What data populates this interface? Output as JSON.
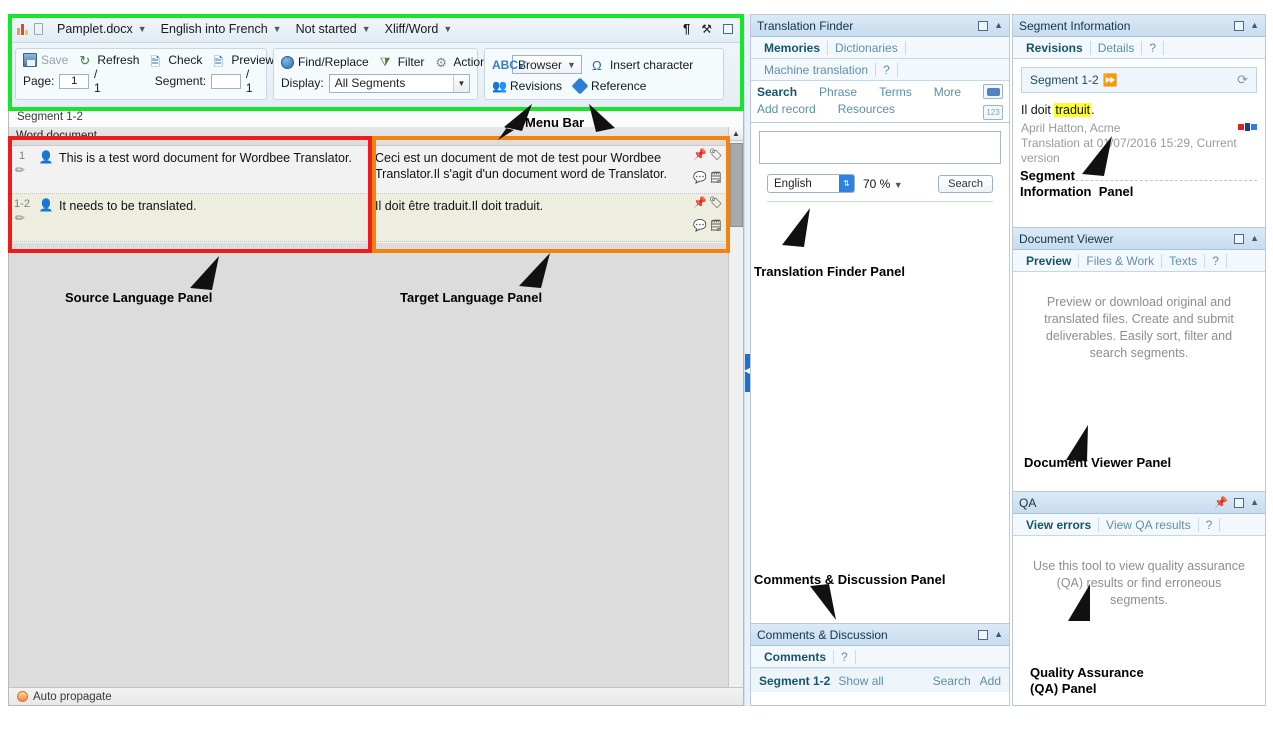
{
  "topbar": {
    "filename": "Pamplet.docx",
    "language_pair": "English into French",
    "status": "Not started",
    "format": "Xliff/Word",
    "icons": {
      "paragraph": "¶",
      "tools": "⚒",
      "window": "▭"
    }
  },
  "toolbar": {
    "save": "Save",
    "refresh": "Refresh",
    "check": "Check",
    "preview": "Preview",
    "page_label": "Page:",
    "page_value": "1",
    "page_total": "/ 1",
    "segment_label": "Segment:",
    "segment_value": "",
    "segment_total": "/ 1",
    "find_replace": "Find/Replace",
    "filter": "Filter",
    "actions": "Actions",
    "display_label": "Display:",
    "display_value": "All Segments",
    "browser": "Browser",
    "insert_character": "Insert character",
    "revisions": "Revisions",
    "reference": "Reference"
  },
  "grid": {
    "segment_strip": "Segment 1-2",
    "source_column_header": "Word document",
    "rows": [
      {
        "number": "1",
        "source": "This is a test word document for Wordbee Translator.",
        "target": "Ceci est un document de mot de test pour Wordbee Translator.Il s'agit d'un document word de Translator."
      },
      {
        "number": "1-2",
        "source": "It needs to be translated.",
        "target": "Il doit être traduit.Il doit traduit."
      }
    ]
  },
  "statusbar": {
    "auto_propagate": "Auto propagate"
  },
  "translation_finder": {
    "title": "Translation Finder",
    "tabs_row1": [
      "Memories",
      "Dictionaries"
    ],
    "tabs_row2": [
      "Machine translation",
      "?"
    ],
    "links_row1": [
      "Search",
      "Phrase",
      "Terms",
      "More"
    ],
    "links_row2": [
      "Add record",
      "Resources"
    ],
    "search_value": "",
    "language": "English",
    "threshold": "70 %",
    "search_button": "Search",
    "badge_number": "123"
  },
  "comments": {
    "title": "Comments & Discussion",
    "tabs": [
      "Comments",
      "?"
    ],
    "segment": "Segment 1-2",
    "show_all": "Show all",
    "search": "Search",
    "add": "Add"
  },
  "segment_information": {
    "title": "Segment Information",
    "tabs": [
      "Revisions",
      "Details",
      "?"
    ],
    "segment_box": "Segment 1-2",
    "revision_text_prefix": "Il doit ",
    "revision_text_highlight": "traduit",
    "revision_text_suffix": ".",
    "author": "April Hatton, Acme",
    "meta": "Translation at 01/07/2016 15:29, Current version"
  },
  "document_viewer": {
    "title": "Document Viewer",
    "tabs": [
      "Preview",
      "Files & Work",
      "Texts",
      "?"
    ],
    "hint": "Preview or download original and translated files. Create and submit deliverables. Easily sort, filter and search segments."
  },
  "qa": {
    "title": "QA",
    "tabs": [
      "View errors",
      "View QA results",
      "?"
    ],
    "hint": "Use this tool to view quality assurance (QA) results or find erroneous segments."
  },
  "annotations": {
    "menu_bar": "Menu Bar",
    "source_panel": "Source Language Panel",
    "target_panel": "Target Language Panel",
    "translation_finder_panel": "Translation Finder Panel",
    "comments_panel": "Comments & Discussion Panel",
    "segment_information_panel": "Segment\nInformation  Panel",
    "document_viewer_panel": "Document Viewer Panel",
    "qa_panel": "Quality Assurance\n(QA) Panel"
  },
  "colors": {
    "menu_highlight": "#18e52a",
    "source_highlight": "#ee1c1c",
    "target_highlight": "#f2830f",
    "panel_header": "#c8dcee",
    "link": "#5b8fa8"
  }
}
